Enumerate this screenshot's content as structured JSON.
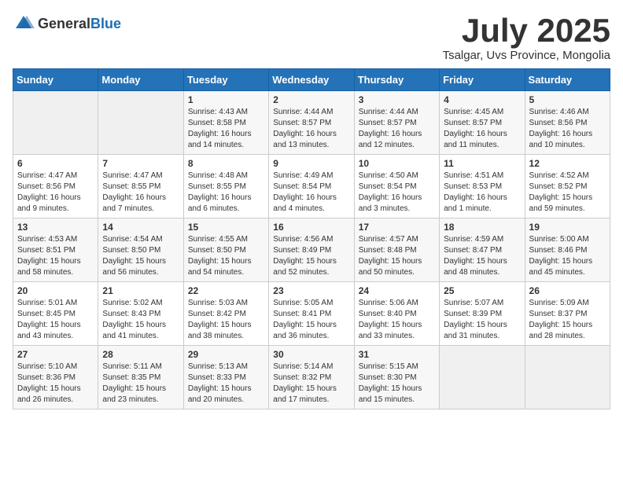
{
  "logo": {
    "general": "General",
    "blue": "Blue"
  },
  "title": {
    "month": "July 2025",
    "location": "Tsalgar, Uvs Province, Mongolia"
  },
  "headers": [
    "Sunday",
    "Monday",
    "Tuesday",
    "Wednesday",
    "Thursday",
    "Friday",
    "Saturday"
  ],
  "weeks": [
    [
      {
        "day": "",
        "sunrise": "",
        "sunset": "",
        "daylight": ""
      },
      {
        "day": "",
        "sunrise": "",
        "sunset": "",
        "daylight": ""
      },
      {
        "day": "1",
        "sunrise": "Sunrise: 4:43 AM",
        "sunset": "Sunset: 8:58 PM",
        "daylight": "Daylight: 16 hours and 14 minutes."
      },
      {
        "day": "2",
        "sunrise": "Sunrise: 4:44 AM",
        "sunset": "Sunset: 8:57 PM",
        "daylight": "Daylight: 16 hours and 13 minutes."
      },
      {
        "day": "3",
        "sunrise": "Sunrise: 4:44 AM",
        "sunset": "Sunset: 8:57 PM",
        "daylight": "Daylight: 16 hours and 12 minutes."
      },
      {
        "day": "4",
        "sunrise": "Sunrise: 4:45 AM",
        "sunset": "Sunset: 8:57 PM",
        "daylight": "Daylight: 16 hours and 11 minutes."
      },
      {
        "day": "5",
        "sunrise": "Sunrise: 4:46 AM",
        "sunset": "Sunset: 8:56 PM",
        "daylight": "Daylight: 16 hours and 10 minutes."
      }
    ],
    [
      {
        "day": "6",
        "sunrise": "Sunrise: 4:47 AM",
        "sunset": "Sunset: 8:56 PM",
        "daylight": "Daylight: 16 hours and 9 minutes."
      },
      {
        "day": "7",
        "sunrise": "Sunrise: 4:47 AM",
        "sunset": "Sunset: 8:55 PM",
        "daylight": "Daylight: 16 hours and 7 minutes."
      },
      {
        "day": "8",
        "sunrise": "Sunrise: 4:48 AM",
        "sunset": "Sunset: 8:55 PM",
        "daylight": "Daylight: 16 hours and 6 minutes."
      },
      {
        "day": "9",
        "sunrise": "Sunrise: 4:49 AM",
        "sunset": "Sunset: 8:54 PM",
        "daylight": "Daylight: 16 hours and 4 minutes."
      },
      {
        "day": "10",
        "sunrise": "Sunrise: 4:50 AM",
        "sunset": "Sunset: 8:54 PM",
        "daylight": "Daylight: 16 hours and 3 minutes."
      },
      {
        "day": "11",
        "sunrise": "Sunrise: 4:51 AM",
        "sunset": "Sunset: 8:53 PM",
        "daylight": "Daylight: 16 hours and 1 minute."
      },
      {
        "day": "12",
        "sunrise": "Sunrise: 4:52 AM",
        "sunset": "Sunset: 8:52 PM",
        "daylight": "Daylight: 15 hours and 59 minutes."
      }
    ],
    [
      {
        "day": "13",
        "sunrise": "Sunrise: 4:53 AM",
        "sunset": "Sunset: 8:51 PM",
        "daylight": "Daylight: 15 hours and 58 minutes."
      },
      {
        "day": "14",
        "sunrise": "Sunrise: 4:54 AM",
        "sunset": "Sunset: 8:50 PM",
        "daylight": "Daylight: 15 hours and 56 minutes."
      },
      {
        "day": "15",
        "sunrise": "Sunrise: 4:55 AM",
        "sunset": "Sunset: 8:50 PM",
        "daylight": "Daylight: 15 hours and 54 minutes."
      },
      {
        "day": "16",
        "sunrise": "Sunrise: 4:56 AM",
        "sunset": "Sunset: 8:49 PM",
        "daylight": "Daylight: 15 hours and 52 minutes."
      },
      {
        "day": "17",
        "sunrise": "Sunrise: 4:57 AM",
        "sunset": "Sunset: 8:48 PM",
        "daylight": "Daylight: 15 hours and 50 minutes."
      },
      {
        "day": "18",
        "sunrise": "Sunrise: 4:59 AM",
        "sunset": "Sunset: 8:47 PM",
        "daylight": "Daylight: 15 hours and 48 minutes."
      },
      {
        "day": "19",
        "sunrise": "Sunrise: 5:00 AM",
        "sunset": "Sunset: 8:46 PM",
        "daylight": "Daylight: 15 hours and 45 minutes."
      }
    ],
    [
      {
        "day": "20",
        "sunrise": "Sunrise: 5:01 AM",
        "sunset": "Sunset: 8:45 PM",
        "daylight": "Daylight: 15 hours and 43 minutes."
      },
      {
        "day": "21",
        "sunrise": "Sunrise: 5:02 AM",
        "sunset": "Sunset: 8:43 PM",
        "daylight": "Daylight: 15 hours and 41 minutes."
      },
      {
        "day": "22",
        "sunrise": "Sunrise: 5:03 AM",
        "sunset": "Sunset: 8:42 PM",
        "daylight": "Daylight: 15 hours and 38 minutes."
      },
      {
        "day": "23",
        "sunrise": "Sunrise: 5:05 AM",
        "sunset": "Sunset: 8:41 PM",
        "daylight": "Daylight: 15 hours and 36 minutes."
      },
      {
        "day": "24",
        "sunrise": "Sunrise: 5:06 AM",
        "sunset": "Sunset: 8:40 PM",
        "daylight": "Daylight: 15 hours and 33 minutes."
      },
      {
        "day": "25",
        "sunrise": "Sunrise: 5:07 AM",
        "sunset": "Sunset: 8:39 PM",
        "daylight": "Daylight: 15 hours and 31 minutes."
      },
      {
        "day": "26",
        "sunrise": "Sunrise: 5:09 AM",
        "sunset": "Sunset: 8:37 PM",
        "daylight": "Daylight: 15 hours and 28 minutes."
      }
    ],
    [
      {
        "day": "27",
        "sunrise": "Sunrise: 5:10 AM",
        "sunset": "Sunset: 8:36 PM",
        "daylight": "Daylight: 15 hours and 26 minutes."
      },
      {
        "day": "28",
        "sunrise": "Sunrise: 5:11 AM",
        "sunset": "Sunset: 8:35 PM",
        "daylight": "Daylight: 15 hours and 23 minutes."
      },
      {
        "day": "29",
        "sunrise": "Sunrise: 5:13 AM",
        "sunset": "Sunset: 8:33 PM",
        "daylight": "Daylight: 15 hours and 20 minutes."
      },
      {
        "day": "30",
        "sunrise": "Sunrise: 5:14 AM",
        "sunset": "Sunset: 8:32 PM",
        "daylight": "Daylight: 15 hours and 17 minutes."
      },
      {
        "day": "31",
        "sunrise": "Sunrise: 5:15 AM",
        "sunset": "Sunset: 8:30 PM",
        "daylight": "Daylight: 15 hours and 15 minutes."
      },
      {
        "day": "",
        "sunrise": "",
        "sunset": "",
        "daylight": ""
      },
      {
        "day": "",
        "sunrise": "",
        "sunset": "",
        "daylight": ""
      }
    ]
  ]
}
